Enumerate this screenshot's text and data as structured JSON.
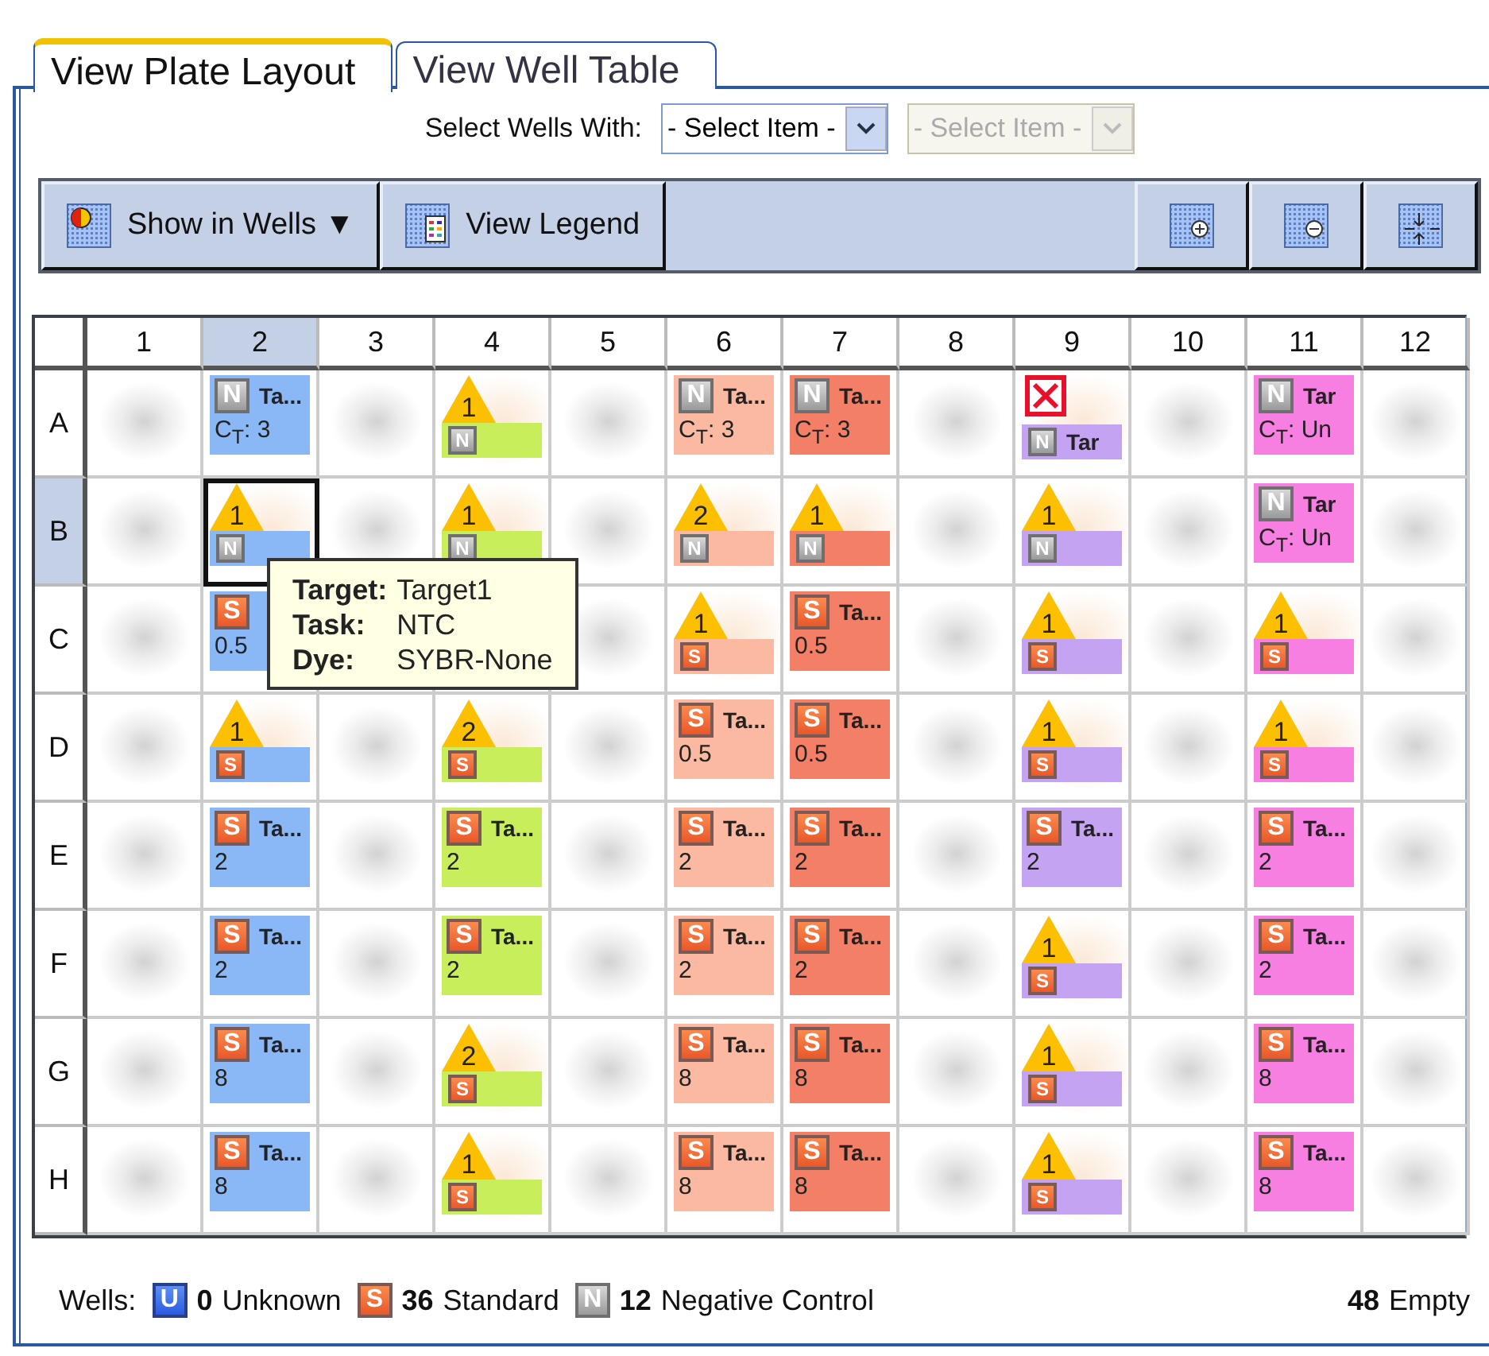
{
  "tabs": [
    {
      "label": "View Plate Layout",
      "selected": true
    },
    {
      "label": "View Well Table",
      "selected": false
    }
  ],
  "select_wells": {
    "label": "Select Wells With:",
    "dropdowns": [
      {
        "value": "- Select Item -",
        "disabled": false
      },
      {
        "value": "- Select Item -",
        "disabled": true
      }
    ]
  },
  "toolbar": {
    "buttons": [
      {
        "kind": "show",
        "label": "Show in Wells",
        "caret": "▼"
      },
      {
        "kind": "legend",
        "label": "View Legend"
      }
    ],
    "icon_buttons": [
      {
        "kind": "zoom-in"
      },
      {
        "kind": "zoom-out"
      },
      {
        "kind": "fit"
      }
    ]
  },
  "plate": {
    "columns": [
      {
        "label": "1",
        "selected": false
      },
      {
        "label": "2",
        "selected": true
      },
      {
        "label": "3",
        "selected": false
      },
      {
        "label": "4",
        "selected": false
      },
      {
        "label": "5",
        "selected": false
      },
      {
        "label": "6",
        "selected": false
      },
      {
        "label": "7",
        "selected": false
      },
      {
        "label": "8",
        "selected": false
      },
      {
        "label": "9",
        "selected": false
      },
      {
        "label": "10",
        "selected": false
      },
      {
        "label": "11",
        "selected": false
      },
      {
        "label": "12",
        "selected": false
      }
    ],
    "rows": [
      {
        "label": "A",
        "selected": false,
        "wells": [
          {
            "kind": "empty",
            "selected": false
          },
          {
            "kind": "sample",
            "badge": {
              "kind": "negative",
              "letter": "N"
            },
            "target": "Ta...",
            "value": "C$_{T}$: 3",
            "color": "#8ab8f6",
            "selected": false
          },
          {
            "kind": "empty",
            "selected": false
          },
          {
            "kind": "flagged",
            "flag": "1",
            "badge": {
              "kind": "negative",
              "letter": "N"
            },
            "color": "#c8ee5c",
            "selected": false
          },
          {
            "kind": "empty",
            "selected": false
          },
          {
            "kind": "sample",
            "badge": {
              "kind": "negative",
              "letter": "N"
            },
            "target": "Ta...",
            "value": "C$_{T}$: 3",
            "color": "#fcb9a1",
            "selected": false
          },
          {
            "kind": "sample",
            "badge": {
              "kind": "negative",
              "letter": "N"
            },
            "target": "Ta...",
            "value": "C$_{T}$: 3",
            "color": "#f37f66",
            "selected": false
          },
          {
            "kind": "empty",
            "selected": false
          },
          {
            "kind": "omitted",
            "badge": {
              "kind": "negative",
              "letter": "N"
            },
            "target": "Tar",
            "color": "#c4a3f2",
            "selected": false
          },
          {
            "kind": "empty",
            "selected": false
          },
          {
            "kind": "sample",
            "badge": {
              "kind": "negative",
              "letter": "N"
            },
            "target": "Tar",
            "value": "C$_{T}$: Un",
            "color": "#f77fe2",
            "selected": false
          },
          {
            "kind": "empty",
            "selected": false
          }
        ]
      },
      {
        "label": "B",
        "selected": true,
        "wells": [
          {
            "kind": "empty",
            "selected": false
          },
          {
            "kind": "flagged",
            "flag": "1",
            "badge": {
              "kind": "negative",
              "letter": "N"
            },
            "color": "#8ab8f6",
            "selected": true
          },
          {
            "kind": "empty",
            "selected": false
          },
          {
            "kind": "flagged",
            "flag": "1",
            "badge": {
              "kind": "negative",
              "letter": "N"
            },
            "color": "#c8ee5c",
            "selected": false
          },
          {
            "kind": "empty",
            "selected": false
          },
          {
            "kind": "flagged",
            "flag": "2",
            "badge": {
              "kind": "negative",
              "letter": "N"
            },
            "color": "#fcb9a1",
            "selected": false
          },
          {
            "kind": "flagged",
            "flag": "1",
            "badge": {
              "kind": "negative",
              "letter": "N"
            },
            "color": "#f37f66",
            "selected": false
          },
          {
            "kind": "empty",
            "selected": false
          },
          {
            "kind": "flagged",
            "flag": "1",
            "badge": {
              "kind": "negative",
              "letter": "N"
            },
            "color": "#c4a3f2",
            "selected": false
          },
          {
            "kind": "empty",
            "selected": false
          },
          {
            "kind": "sample",
            "badge": {
              "kind": "negative",
              "letter": "N"
            },
            "target": "Tar",
            "value": "C$_{T}$: Un",
            "color": "#f77fe2",
            "selected": false
          },
          {
            "kind": "empty",
            "selected": false
          }
        ]
      },
      {
        "label": "C",
        "selected": false,
        "wells": [
          {
            "kind": "empty",
            "selected": false
          },
          {
            "kind": "sample",
            "badge": {
              "kind": "standard",
              "letter": "S"
            },
            "value": "0.5",
            "color": "#8ab8f6",
            "selected": false
          },
          {
            "kind": "covered"
          },
          {
            "kind": "covered"
          },
          {
            "kind": "empty",
            "selected": false
          },
          {
            "kind": "flagged",
            "flag": "1",
            "badge": {
              "kind": "standard",
              "letter": "S"
            },
            "color": "#fcb9a1",
            "selected": false
          },
          {
            "kind": "sample",
            "badge": {
              "kind": "standard",
              "letter": "S"
            },
            "target": "Ta...",
            "value": "0.5",
            "color": "#f37f66",
            "selected": false
          },
          {
            "kind": "empty",
            "selected": false
          },
          {
            "kind": "flagged",
            "flag": "1",
            "badge": {
              "kind": "standard",
              "letter": "S"
            },
            "color": "#c4a3f2",
            "selected": false
          },
          {
            "kind": "empty",
            "selected": false
          },
          {
            "kind": "flagged",
            "flag": "1",
            "badge": {
              "kind": "standard",
              "letter": "S"
            },
            "color": "#f77fe2",
            "selected": false
          },
          {
            "kind": "empty",
            "selected": false
          }
        ]
      },
      {
        "label": "D",
        "selected": false,
        "wells": [
          {
            "kind": "empty",
            "selected": false
          },
          {
            "kind": "flagged",
            "flag": "1",
            "badge": {
              "kind": "standard",
              "letter": "S"
            },
            "color": "#8ab8f6",
            "selected": false
          },
          {
            "kind": "empty",
            "selected": false
          },
          {
            "kind": "flagged",
            "flag": "2",
            "badge": {
              "kind": "standard",
              "letter": "S"
            },
            "color": "#c8ee5c",
            "selected": false
          },
          {
            "kind": "empty",
            "selected": false
          },
          {
            "kind": "sample",
            "badge": {
              "kind": "standard",
              "letter": "S"
            },
            "target": "Ta...",
            "value": "0.5",
            "color": "#fcb9a1",
            "selected": false
          },
          {
            "kind": "sample",
            "badge": {
              "kind": "standard",
              "letter": "S"
            },
            "target": "Ta...",
            "value": "0.5",
            "color": "#f37f66",
            "selected": false
          },
          {
            "kind": "empty",
            "selected": false
          },
          {
            "kind": "flagged",
            "flag": "1",
            "badge": {
              "kind": "standard",
              "letter": "S"
            },
            "color": "#c4a3f2",
            "selected": false
          },
          {
            "kind": "empty",
            "selected": false
          },
          {
            "kind": "flagged",
            "flag": "1",
            "badge": {
              "kind": "standard",
              "letter": "S"
            },
            "color": "#f77fe2",
            "selected": false
          },
          {
            "kind": "empty",
            "selected": false
          }
        ]
      },
      {
        "label": "E",
        "selected": false,
        "wells": [
          {
            "kind": "empty",
            "selected": false
          },
          {
            "kind": "sample",
            "badge": {
              "kind": "standard",
              "letter": "S"
            },
            "target": "Ta...",
            "value": "2",
            "color": "#8ab8f6",
            "selected": false
          },
          {
            "kind": "empty",
            "selected": false
          },
          {
            "kind": "sample",
            "badge": {
              "kind": "standard",
              "letter": "S"
            },
            "target": "Ta...",
            "value": "2",
            "color": "#c8ee5c",
            "selected": false
          },
          {
            "kind": "empty",
            "selected": false
          },
          {
            "kind": "sample",
            "badge": {
              "kind": "standard",
              "letter": "S"
            },
            "target": "Ta...",
            "value": "2",
            "color": "#fcb9a1",
            "selected": false
          },
          {
            "kind": "sample",
            "badge": {
              "kind": "standard",
              "letter": "S"
            },
            "target": "Ta...",
            "value": "2",
            "color": "#f37f66",
            "selected": false
          },
          {
            "kind": "empty",
            "selected": false
          },
          {
            "kind": "sample",
            "badge": {
              "kind": "standard",
              "letter": "S"
            },
            "target": "Ta...",
            "value": "2",
            "color": "#c4a3f2",
            "selected": false
          },
          {
            "kind": "empty",
            "selected": false
          },
          {
            "kind": "sample",
            "badge": {
              "kind": "standard",
              "letter": "S"
            },
            "target": "Ta...",
            "value": "2",
            "color": "#f77fe2",
            "selected": false
          },
          {
            "kind": "empty",
            "selected": false
          }
        ]
      },
      {
        "label": "F",
        "selected": false,
        "wells": [
          {
            "kind": "empty",
            "selected": false
          },
          {
            "kind": "sample",
            "badge": {
              "kind": "standard",
              "letter": "S"
            },
            "target": "Ta...",
            "value": "2",
            "color": "#8ab8f6",
            "selected": false
          },
          {
            "kind": "empty",
            "selected": false
          },
          {
            "kind": "sample",
            "badge": {
              "kind": "standard",
              "letter": "S"
            },
            "target": "Ta...",
            "value": "2",
            "color": "#c8ee5c",
            "selected": false
          },
          {
            "kind": "empty",
            "selected": false
          },
          {
            "kind": "sample",
            "badge": {
              "kind": "standard",
              "letter": "S"
            },
            "target": "Ta...",
            "value": "2",
            "color": "#fcb9a1",
            "selected": false
          },
          {
            "kind": "sample",
            "badge": {
              "kind": "standard",
              "letter": "S"
            },
            "target": "Ta...",
            "value": "2",
            "color": "#f37f66",
            "selected": false
          },
          {
            "kind": "empty",
            "selected": false
          },
          {
            "kind": "flagged",
            "flag": "1",
            "badge": {
              "kind": "standard",
              "letter": "S"
            },
            "color": "#c4a3f2",
            "selected": false
          },
          {
            "kind": "empty",
            "selected": false
          },
          {
            "kind": "sample",
            "badge": {
              "kind": "standard",
              "letter": "S"
            },
            "target": "Ta...",
            "value": "2",
            "color": "#f77fe2",
            "selected": false
          },
          {
            "kind": "empty",
            "selected": false
          }
        ]
      },
      {
        "label": "G",
        "selected": false,
        "wells": [
          {
            "kind": "empty",
            "selected": false
          },
          {
            "kind": "sample",
            "badge": {
              "kind": "standard",
              "letter": "S"
            },
            "target": "Ta...",
            "value": "8",
            "color": "#8ab8f6",
            "selected": false
          },
          {
            "kind": "empty",
            "selected": false
          },
          {
            "kind": "flagged",
            "flag": "2",
            "badge": {
              "kind": "standard",
              "letter": "S"
            },
            "color": "#c8ee5c",
            "selected": false
          },
          {
            "kind": "empty",
            "selected": false
          },
          {
            "kind": "sample",
            "badge": {
              "kind": "standard",
              "letter": "S"
            },
            "target": "Ta...",
            "value": "8",
            "color": "#fcb9a1",
            "selected": false
          },
          {
            "kind": "sample",
            "badge": {
              "kind": "standard",
              "letter": "S"
            },
            "target": "Ta...",
            "value": "8",
            "color": "#f37f66",
            "selected": false
          },
          {
            "kind": "empty",
            "selected": false
          },
          {
            "kind": "flagged",
            "flag": "1",
            "badge": {
              "kind": "standard",
              "letter": "S"
            },
            "color": "#c4a3f2",
            "selected": false
          },
          {
            "kind": "empty",
            "selected": false
          },
          {
            "kind": "sample",
            "badge": {
              "kind": "standard",
              "letter": "S"
            },
            "target": "Ta...",
            "value": "8",
            "color": "#f77fe2",
            "selected": false
          },
          {
            "kind": "empty",
            "selected": false
          }
        ]
      },
      {
        "label": "H",
        "selected": false,
        "wells": [
          {
            "kind": "empty",
            "selected": false
          },
          {
            "kind": "sample",
            "badge": {
              "kind": "standard",
              "letter": "S"
            },
            "target": "Ta...",
            "value": "8",
            "color": "#8ab8f6",
            "selected": false
          },
          {
            "kind": "empty",
            "selected": false
          },
          {
            "kind": "flagged",
            "flag": "1",
            "badge": {
              "kind": "standard",
              "letter": "S"
            },
            "color": "#c8ee5c",
            "selected": false
          },
          {
            "kind": "empty",
            "selected": false
          },
          {
            "kind": "sample",
            "badge": {
              "kind": "standard",
              "letter": "S"
            },
            "target": "Ta...",
            "value": "8",
            "color": "#fcb9a1",
            "selected": false
          },
          {
            "kind": "sample",
            "badge": {
              "kind": "standard",
              "letter": "S"
            },
            "target": "Ta...",
            "value": "8",
            "color": "#f37f66",
            "selected": false
          },
          {
            "kind": "empty",
            "selected": false
          },
          {
            "kind": "flagged",
            "flag": "1",
            "badge": {
              "kind": "standard",
              "letter": "S"
            },
            "color": "#c4a3f2",
            "selected": false
          },
          {
            "kind": "empty",
            "selected": false
          },
          {
            "kind": "sample",
            "badge": {
              "kind": "standard",
              "letter": "S"
            },
            "target": "Ta...",
            "value": "8",
            "color": "#f77fe2",
            "selected": false
          },
          {
            "kind": "empty",
            "selected": false
          }
        ]
      }
    ],
    "tooltip": [
      {
        "label": "Target:",
        "value": "Target1"
      },
      {
        "label": "Task:",
        "value": "NTC"
      },
      {
        "label": "Dye:",
        "value": "SYBR-None"
      }
    ]
  },
  "legend": {
    "label": "Wells:",
    "items": [
      {
        "badge": {
          "kind": "unknown",
          "letter": "U"
        },
        "count": "0",
        "label": "Unknown"
      },
      {
        "badge": {
          "kind": "standard",
          "letter": "S"
        },
        "count": "36",
        "label": "Standard"
      },
      {
        "badge": {
          "kind": "negative",
          "letter": "N"
        },
        "count": "12",
        "label": "Negative Control"
      }
    ],
    "empty": {
      "count": "48",
      "label": "Empty"
    }
  }
}
